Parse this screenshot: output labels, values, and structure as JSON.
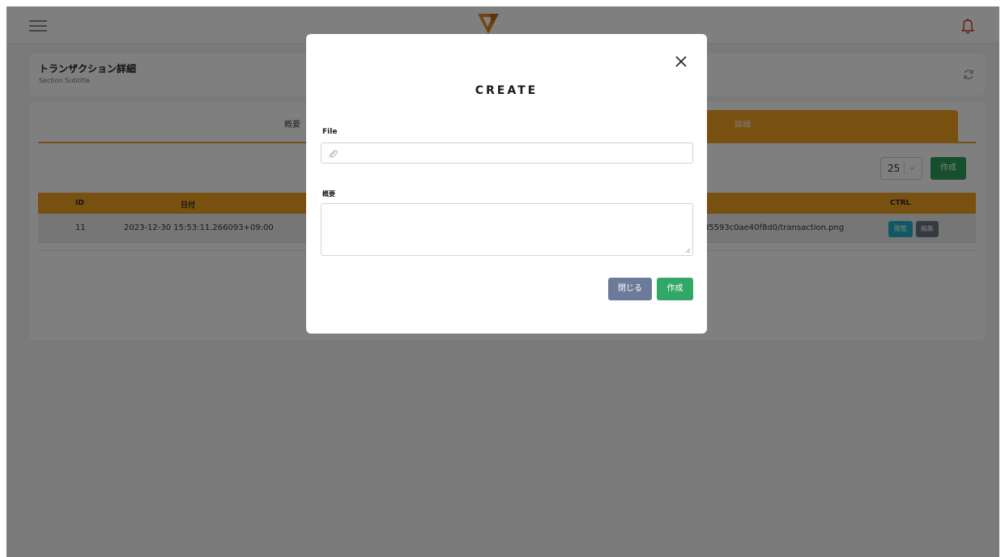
{
  "header": {
    "menu_icon": "hamburger-icon",
    "logo_icon": "logo-icon",
    "notification_icon": "bell-icon",
    "notification_color": "#d0342c"
  },
  "section": {
    "title": "トランザクション詳細",
    "subtitle": "Section Subtitle",
    "refresh_icon": "refresh-icon"
  },
  "tabs": [
    {
      "label": "概要",
      "active": false
    },
    {
      "label": "詳細",
      "active": true
    }
  ],
  "toolbar": {
    "page_size": "25",
    "create_label": "作成"
  },
  "table": {
    "columns": [
      "ID",
      "日付",
      "CTRL"
    ],
    "rows": [
      {
        "id": "11",
        "date": "2023-12-30 15:53:11.266093+09:00",
        "file": "fbd5593c0ae40f8d0/transaction.png",
        "view_label": "閲覧",
        "edit_label": "編集"
      }
    ]
  },
  "modal": {
    "title": "CREATE",
    "file_label": "File",
    "file_value": "",
    "summary_label": "概要",
    "summary_value": "",
    "close_label": "閉じる",
    "create_label": "作成"
  },
  "colors": {
    "accent": "#f0a020",
    "create_green": "#2f9d5c",
    "close_gray": "#6b7b99",
    "view_teal": "#1fb0c8",
    "edit_gray": "#6b7385"
  }
}
